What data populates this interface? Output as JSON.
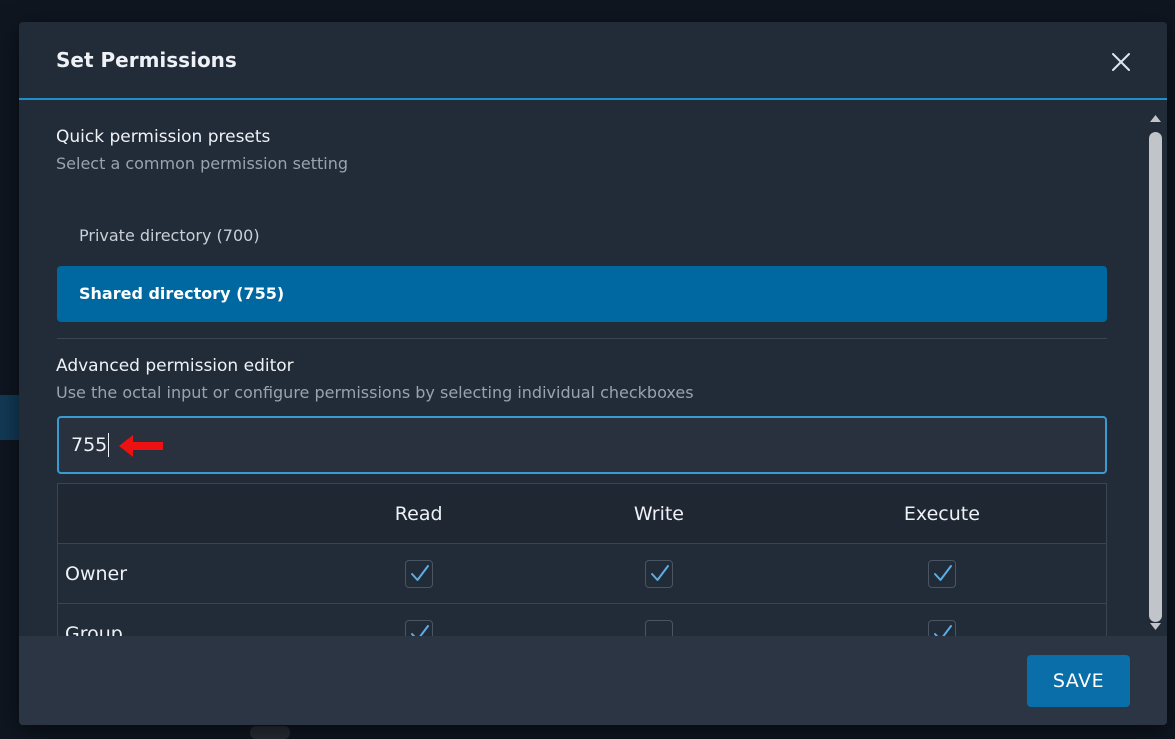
{
  "dialog": {
    "title": "Set Permissions",
    "close_icon": "close-icon"
  },
  "presets": {
    "title": "Quick permission presets",
    "subtitle": "Select a common permission setting",
    "items": [
      {
        "label": "Private directory (700)",
        "selected": false
      },
      {
        "label": "Shared directory (755)",
        "selected": true
      }
    ]
  },
  "advanced": {
    "title": "Advanced permission editor",
    "subtitle": "Use the octal input or configure permissions by selecting individual checkboxes",
    "octal_value": "755",
    "table": {
      "headers": [
        "",
        "Read",
        "Write",
        "Execute"
      ],
      "rows": [
        {
          "role": "Owner",
          "read": true,
          "write": true,
          "execute": true
        },
        {
          "role": "Group",
          "read": true,
          "write": false,
          "execute": true
        }
      ]
    }
  },
  "footer": {
    "save_label": "SAVE"
  },
  "colors": {
    "accent": "#1d8fce",
    "selected_preset": "#0068a1",
    "annotation_arrow": "#ee1111"
  }
}
